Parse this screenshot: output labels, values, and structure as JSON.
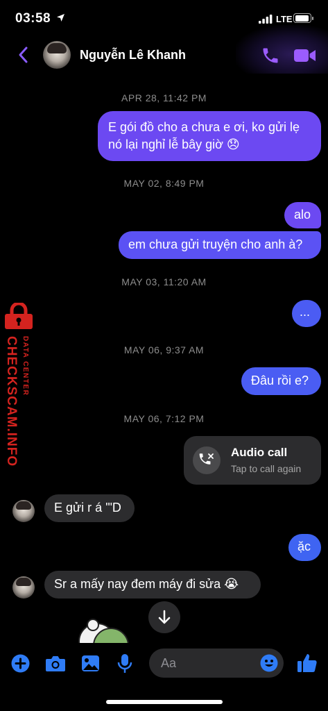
{
  "status": {
    "time": "03:58",
    "network": "LTE"
  },
  "header": {
    "contact_name": "Nguyễn Lê Khanh"
  },
  "messages": {
    "ts1": "APR 28, 11:42 PM",
    "m1_line1": "E gói đồ cho a chưa e ơi, ko gửi lẹ",
    "m1_line2": "nó lại nghỉ lễ bây giờ 😞",
    "ts2": "MAY 02, 8:49 PM",
    "m2": "alo",
    "m3": "em chưa gửi truyện cho anh à?",
    "ts3": "MAY 03, 11:20 AM",
    "m4": "...",
    "ts4": "MAY 06, 9:37 AM",
    "m5": "Đâu rồi e?",
    "ts5": "MAY 06, 7:12 PM",
    "call_title": "Audio call",
    "call_subtitle": "Tap to call again",
    "m6": "E gửi r á '\"D",
    "m7": "ặc",
    "m8": "Sr a mấy nay đem máy đi sửa 😭"
  },
  "composer": {
    "placeholder": "Aa"
  },
  "watermark": {
    "main": "CHECKSCAM.INFO",
    "sub": "DATA CENTER"
  },
  "colors": {
    "outgoing": "#6c49f2",
    "outgoing_blue": "#3f64f2",
    "incoming": "#2c2c2e",
    "accent": "#8a5cff",
    "toolbar_icon": "#2f7cf6",
    "watermark": "#d4231f"
  },
  "icons": [
    "location-arrow-icon",
    "signal-icon",
    "battery-icon",
    "back-chevron-icon",
    "phone-icon",
    "video-icon",
    "missed-call-icon",
    "arrow-down-icon",
    "plus-icon",
    "camera-icon",
    "image-icon",
    "microphone-icon",
    "emoji-icon",
    "thumbs-up-icon",
    "lock-icon"
  ]
}
